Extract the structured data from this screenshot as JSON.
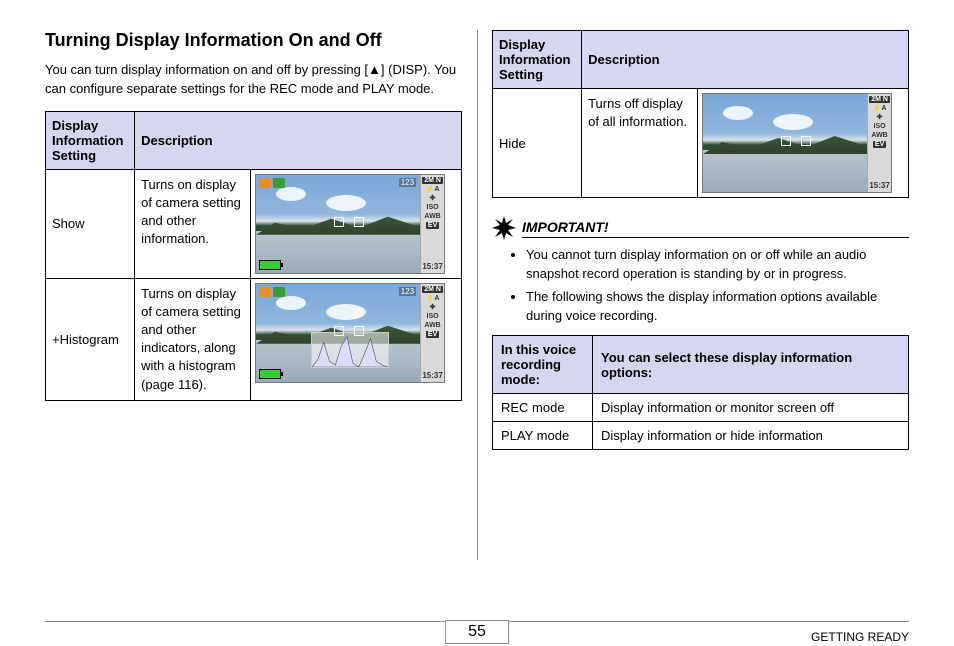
{
  "heading": "Turning Display Information On and Off",
  "intro_parts": {
    "a": "You can turn display information on and off by pressing [",
    "tri": "▲",
    "b": "] (DISP). You can configure separate settings for the REC mode and PLAY mode."
  },
  "table1": {
    "head1": "Display Information Setting",
    "head2": "Description",
    "rows": [
      {
        "label": "Show",
        "desc": "Turns on display of camera setting and other information."
      },
      {
        "label": "+Histogram",
        "desc": "Turns on display of camera setting and other indicators, along with a histogram (page 116)."
      }
    ]
  },
  "table2": {
    "head1": "Display Information Setting",
    "head2": "Description",
    "rows": [
      {
        "label": "Hide",
        "desc": "Turns off display of all information."
      }
    ]
  },
  "thumb": {
    "count": "123",
    "side": {
      "top": "2M N",
      "flash": "⚡A",
      "iso": "ISO",
      "awb": "AWB",
      "ev": "EV"
    },
    "time": "15:37"
  },
  "important_label": "IMPORTANT!",
  "notes": [
    "You cannot turn display information on or off while an audio snapshot record operation is standing by or in progress.",
    "The following shows the display information options available during voice recording."
  ],
  "voice_table": {
    "head1": "In this voice recording mode:",
    "head2": "You can select these display information options:",
    "rows": [
      {
        "mode": "REC mode",
        "opts": "Display information or monitor screen off"
      },
      {
        "mode": "PLAY mode",
        "opts": "Display information or hide information"
      }
    ]
  },
  "page_number": "55",
  "section": "GETTING READY"
}
